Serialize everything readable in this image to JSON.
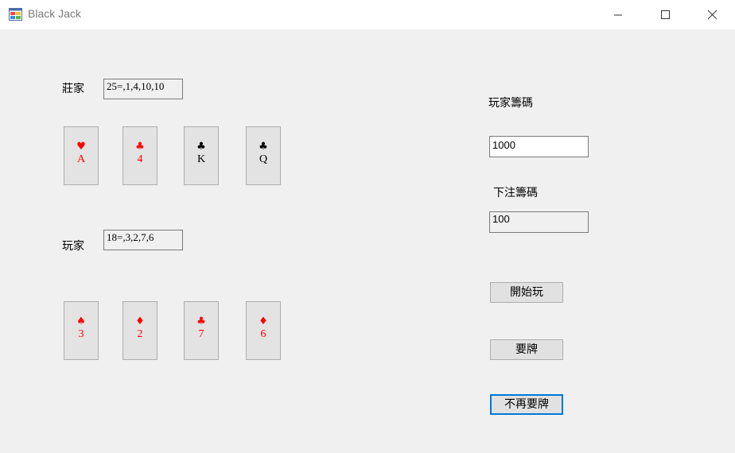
{
  "window": {
    "title": "Black Jack",
    "controls": [
      "minimize",
      "maximize",
      "close"
    ]
  },
  "dealer": {
    "label": "莊家",
    "summary": "25=,1,4,10,10",
    "cards": [
      {
        "suit": "♥",
        "rank": "A",
        "color": "#ff0000"
      },
      {
        "suit": "♣",
        "rank": "4",
        "color": "#ff0000"
      },
      {
        "suit": "♣",
        "rank": "K",
        "color": "#000000"
      },
      {
        "suit": "♣",
        "rank": "Q",
        "color": "#000000"
      }
    ]
  },
  "player": {
    "label": "玩家",
    "summary": "18=,3,2,7,6",
    "cards": [
      {
        "suit": "♠",
        "rank": "3",
        "color": "#ff0000"
      },
      {
        "suit": "♦",
        "rank": "2",
        "color": "#ff0000"
      },
      {
        "suit": "♣",
        "rank": "7",
        "color": "#ff0000"
      },
      {
        "suit": "♦",
        "rank": "6",
        "color": "#ff0000"
      }
    ]
  },
  "side_panel": {
    "chips_label": "玩家籌碼",
    "chips_value": "1000",
    "bet_label": "下注籌碼",
    "bet_value": "100"
  },
  "buttons": {
    "start": "開始玩",
    "hit": "要牌",
    "stand": "不再要牌"
  },
  "colors": {
    "focus_border": "#0078d7",
    "card_red": "#ff0000",
    "card_black": "#000000"
  }
}
